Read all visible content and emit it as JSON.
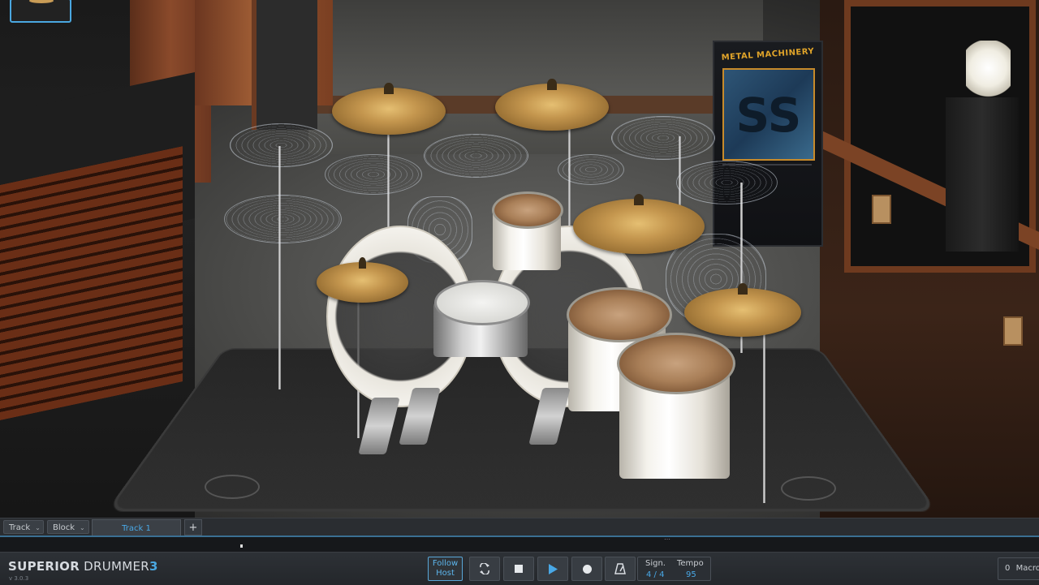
{
  "app": {
    "brand_primary": "SUPERIOR",
    "brand_secondary": "DRUMMER",
    "brand_number": "3",
    "version": "v 3.0.3",
    "accent_color": "#49a8e6"
  },
  "stage": {
    "banner_title": "METAL MACHINERY",
    "banner_logo": "SS"
  },
  "trackbar": {
    "track_label": "Track",
    "block_label": "Block",
    "active_tab": "Track 1",
    "add_label": "+"
  },
  "transport": {
    "follow_host_line1": "Follow",
    "follow_host_line2": "Host",
    "loop_icon": "loop-icon",
    "stop_icon": "stop-icon",
    "play_icon": "play-icon",
    "record_icon": "record-icon",
    "metronome_icon": "metronome-icon",
    "signature_label": "Sign.",
    "signature_value": "4 / 4",
    "tempo_label": "Tempo",
    "tempo_value": "95",
    "macro_count": "0",
    "macro_label": "Macro"
  }
}
